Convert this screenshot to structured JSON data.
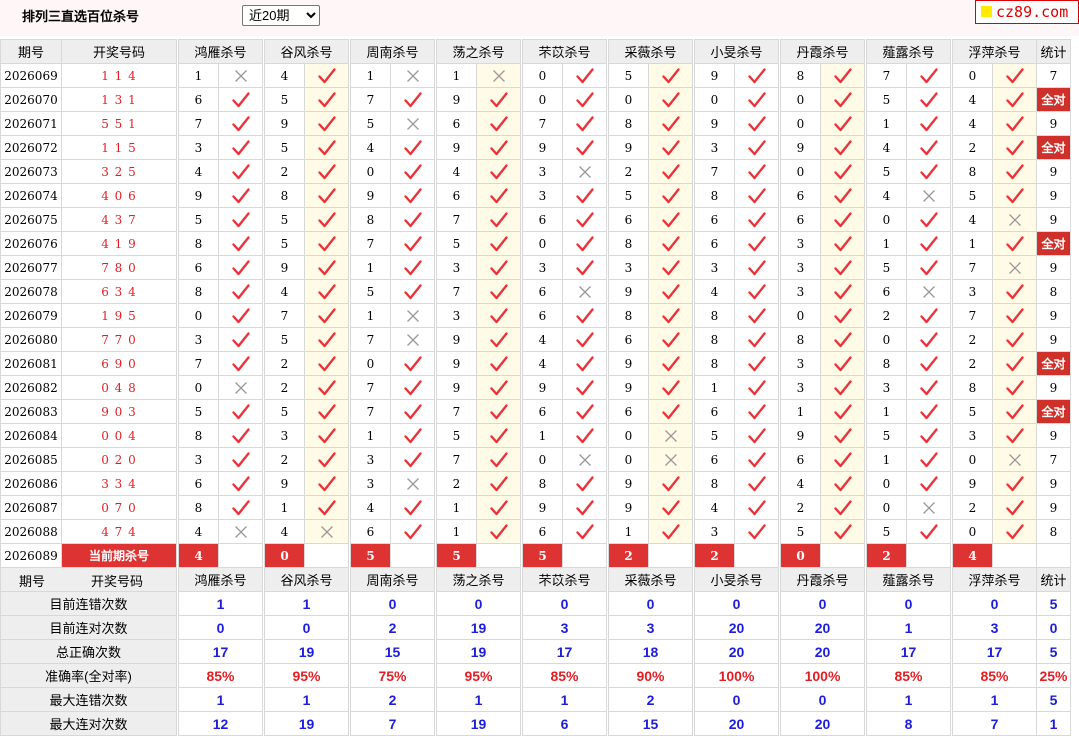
{
  "page": {
    "title": "排列三直选百位杀号",
    "period_select": {
      "selected": "近20期",
      "options": [
        "近20期"
      ]
    },
    "logo": "cz89.com"
  },
  "table": {
    "headers": {
      "period": "期号",
      "numbers": "开奖号码",
      "stat": "统计"
    },
    "experts": [
      "鸿雁杀号",
      "谷风杀号",
      "周南杀号",
      "荡之杀号",
      "芣苡杀号",
      "采薇杀号",
      "小旻杀号",
      "丹霞杀号",
      "薤露杀号",
      "浮萍杀号"
    ],
    "all_right_label": "全对",
    "rows": [
      {
        "period": "2026069",
        "numbers": "1 1 4",
        "kills": [
          1,
          4,
          1,
          1,
          0,
          5,
          9,
          8,
          7,
          0
        ],
        "hits": [
          0,
          1,
          0,
          0,
          1,
          1,
          1,
          1,
          1,
          1
        ],
        "stat": "7"
      },
      {
        "period": "2026070",
        "numbers": "1 3 1",
        "kills": [
          6,
          5,
          7,
          9,
          0,
          0,
          0,
          0,
          5,
          4
        ],
        "hits": [
          1,
          1,
          1,
          1,
          1,
          1,
          1,
          1,
          1,
          1
        ],
        "stat": "全对"
      },
      {
        "period": "2026071",
        "numbers": "5 5 1",
        "kills": [
          7,
          9,
          5,
          6,
          7,
          8,
          9,
          0,
          1,
          4
        ],
        "hits": [
          1,
          1,
          0,
          1,
          1,
          1,
          1,
          1,
          1,
          1
        ],
        "stat": "9"
      },
      {
        "period": "2026072",
        "numbers": "1 1 5",
        "kills": [
          3,
          5,
          4,
          9,
          9,
          9,
          3,
          9,
          4,
          2
        ],
        "hits": [
          1,
          1,
          1,
          1,
          1,
          1,
          1,
          1,
          1,
          1
        ],
        "stat": "全对"
      },
      {
        "period": "2026073",
        "numbers": "3 2 5",
        "kills": [
          4,
          2,
          0,
          4,
          3,
          2,
          7,
          0,
          5,
          8
        ],
        "hits": [
          1,
          1,
          1,
          1,
          0,
          1,
          1,
          1,
          1,
          1
        ],
        "stat": "9"
      },
      {
        "period": "2026074",
        "numbers": "4 0 6",
        "kills": [
          9,
          8,
          9,
          6,
          3,
          5,
          8,
          6,
          4,
          5
        ],
        "hits": [
          1,
          1,
          1,
          1,
          1,
          1,
          1,
          1,
          0,
          1
        ],
        "stat": "9"
      },
      {
        "period": "2026075",
        "numbers": "4 3 7",
        "kills": [
          5,
          5,
          8,
          7,
          6,
          6,
          6,
          6,
          0,
          4
        ],
        "hits": [
          1,
          1,
          1,
          1,
          1,
          1,
          1,
          1,
          1,
          0
        ],
        "stat": "9"
      },
      {
        "period": "2026076",
        "numbers": "4 1 9",
        "kills": [
          8,
          5,
          7,
          5,
          0,
          8,
          6,
          3,
          1,
          1
        ],
        "hits": [
          1,
          1,
          1,
          1,
          1,
          1,
          1,
          1,
          1,
          1
        ],
        "stat": "全对"
      },
      {
        "period": "2026077",
        "numbers": "7 8 0",
        "kills": [
          6,
          9,
          1,
          3,
          3,
          3,
          3,
          3,
          5,
          7
        ],
        "hits": [
          1,
          1,
          1,
          1,
          1,
          1,
          1,
          1,
          1,
          0
        ],
        "stat": "9"
      },
      {
        "period": "2026078",
        "numbers": "6 3 4",
        "kills": [
          8,
          4,
          5,
          7,
          6,
          9,
          4,
          3,
          6,
          3
        ],
        "hits": [
          1,
          1,
          1,
          1,
          0,
          1,
          1,
          1,
          0,
          1
        ],
        "stat": "8"
      },
      {
        "period": "2026079",
        "numbers": "1 9 5",
        "kills": [
          0,
          7,
          1,
          3,
          6,
          8,
          8,
          0,
          2,
          7
        ],
        "hits": [
          1,
          1,
          0,
          1,
          1,
          1,
          1,
          1,
          1,
          1
        ],
        "stat": "9"
      },
      {
        "period": "2026080",
        "numbers": "7 7 0",
        "kills": [
          3,
          5,
          7,
          9,
          4,
          6,
          8,
          8,
          0,
          2
        ],
        "hits": [
          1,
          1,
          0,
          1,
          1,
          1,
          1,
          1,
          1,
          1
        ],
        "stat": "9"
      },
      {
        "period": "2026081",
        "numbers": "6 9 0",
        "kills": [
          7,
          2,
          0,
          9,
          4,
          9,
          8,
          3,
          8,
          2
        ],
        "hits": [
          1,
          1,
          1,
          1,
          1,
          1,
          1,
          1,
          1,
          1
        ],
        "stat": "全对"
      },
      {
        "period": "2026082",
        "numbers": "0 4 8",
        "kills": [
          0,
          2,
          7,
          9,
          9,
          9,
          1,
          3,
          3,
          8
        ],
        "hits": [
          0,
          1,
          1,
          1,
          1,
          1,
          1,
          1,
          1,
          1
        ],
        "stat": "9"
      },
      {
        "period": "2026083",
        "numbers": "9 0 3",
        "kills": [
          5,
          5,
          7,
          7,
          6,
          6,
          6,
          1,
          1,
          5
        ],
        "hits": [
          1,
          1,
          1,
          1,
          1,
          1,
          1,
          1,
          1,
          1
        ],
        "stat": "全对"
      },
      {
        "period": "2026084",
        "numbers": "0 0 4",
        "kills": [
          8,
          3,
          1,
          5,
          1,
          0,
          5,
          9,
          5,
          3
        ],
        "hits": [
          1,
          1,
          1,
          1,
          1,
          0,
          1,
          1,
          1,
          1
        ],
        "stat": "9"
      },
      {
        "period": "2026085",
        "numbers": "0 2 0",
        "kills": [
          3,
          2,
          3,
          7,
          0,
          0,
          6,
          6,
          1,
          0
        ],
        "hits": [
          1,
          1,
          1,
          1,
          0,
          0,
          1,
          1,
          1,
          0
        ],
        "stat": "7"
      },
      {
        "period": "2026086",
        "numbers": "3 3 4",
        "kills": [
          6,
          9,
          3,
          2,
          8,
          9,
          8,
          4,
          0,
          9
        ],
        "hits": [
          1,
          1,
          0,
          1,
          1,
          1,
          1,
          1,
          1,
          1
        ],
        "stat": "9"
      },
      {
        "period": "2026087",
        "numbers": "0 7 0",
        "kills": [
          8,
          1,
          4,
          1,
          9,
          9,
          4,
          2,
          0,
          2
        ],
        "hits": [
          1,
          1,
          1,
          1,
          1,
          1,
          1,
          1,
          0,
          1
        ],
        "stat": "9"
      },
      {
        "period": "2026088",
        "numbers": "4 7 4",
        "kills": [
          4,
          4,
          6,
          1,
          6,
          1,
          3,
          5,
          5,
          0
        ],
        "hits": [
          0,
          0,
          1,
          1,
          1,
          1,
          1,
          1,
          1,
          1
        ],
        "stat": "8"
      }
    ],
    "current": {
      "period": "2026089",
      "label": "当前期杀号",
      "kills": [
        4,
        0,
        5,
        5,
        5,
        2,
        2,
        0,
        2,
        4
      ]
    }
  },
  "summary": {
    "headers": {
      "period": "期号",
      "numbers": "开奖号码",
      "stat": "统计"
    },
    "rows": [
      {
        "label": "目前连错次数",
        "values": [
          "1",
          "1",
          "0",
          "0",
          "0",
          "0",
          "0",
          "0",
          "0",
          "0"
        ],
        "stat": "5",
        "red": false
      },
      {
        "label": "目前连对次数",
        "values": [
          "0",
          "0",
          "2",
          "19",
          "3",
          "3",
          "20",
          "20",
          "1",
          "3"
        ],
        "stat": "0",
        "red": false
      },
      {
        "label": "总正确次数",
        "values": [
          "17",
          "19",
          "15",
          "19",
          "17",
          "18",
          "20",
          "20",
          "17",
          "17"
        ],
        "stat": "5",
        "red": false
      },
      {
        "label": "准确率(全对率)",
        "values": [
          "85%",
          "95%",
          "75%",
          "95%",
          "85%",
          "90%",
          "100%",
          "100%",
          "85%",
          "85%"
        ],
        "stat": "25%",
        "red": true
      },
      {
        "label": "最大连错次数",
        "values": [
          "1",
          "1",
          "2",
          "1",
          "1",
          "2",
          "0",
          "0",
          "1",
          "1"
        ],
        "stat": "5",
        "red": false
      },
      {
        "label": "最大连对次数",
        "values": [
          "12",
          "19",
          "7",
          "19",
          "6",
          "15",
          "20",
          "20",
          "8",
          "7"
        ],
        "stat": "1",
        "red": false
      }
    ]
  }
}
